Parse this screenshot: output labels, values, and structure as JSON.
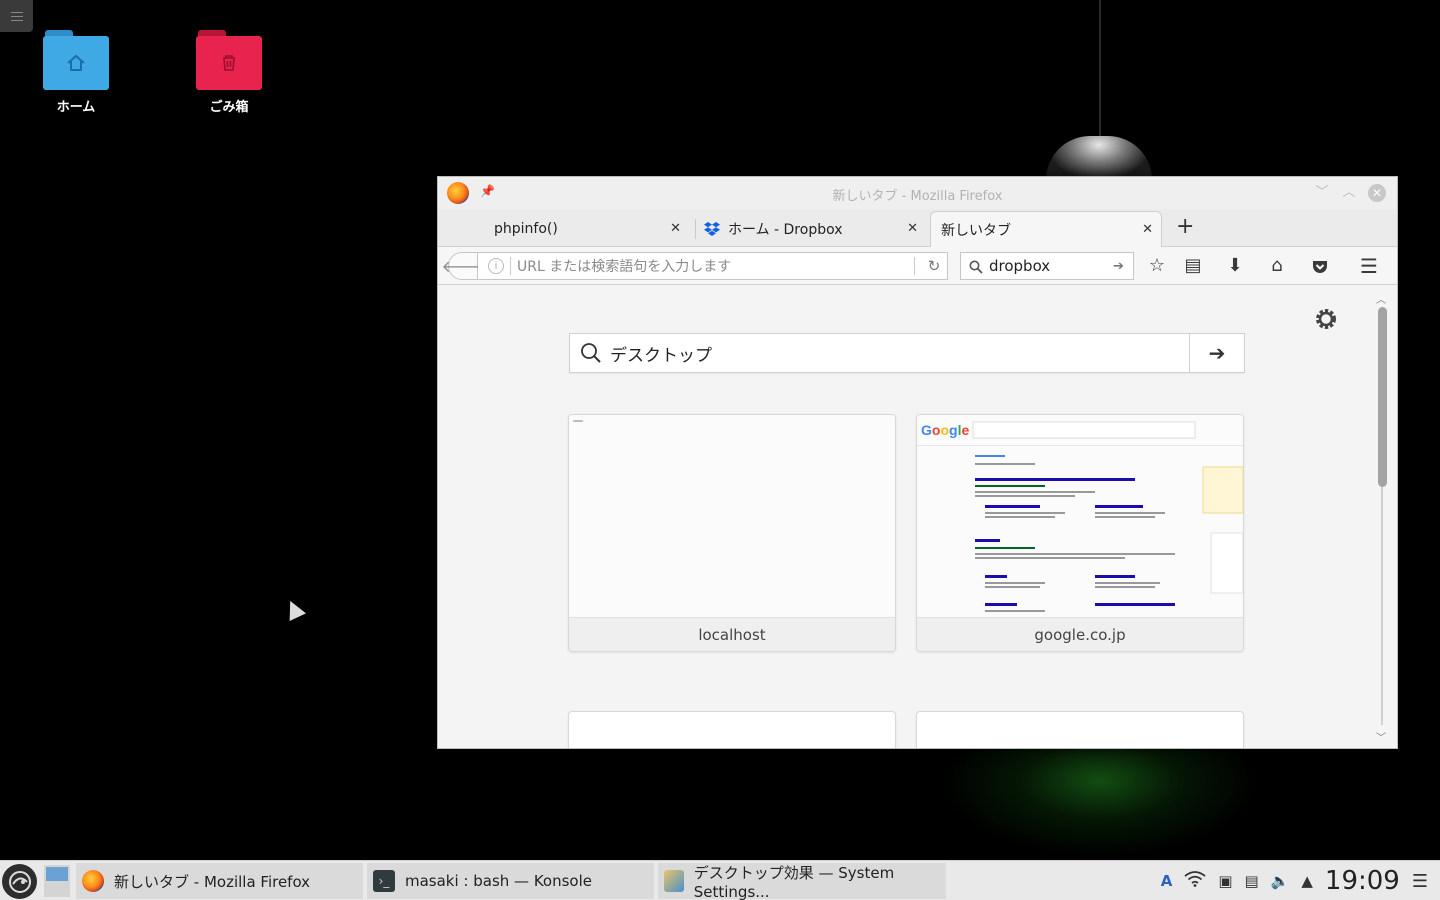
{
  "desktop": {
    "icons": [
      {
        "label": "ホーム"
      },
      {
        "label": "ごみ箱"
      }
    ]
  },
  "window": {
    "title": "新しいタブ - Mozilla Firefox",
    "tabs": [
      {
        "label": "phpinfo()"
      },
      {
        "label": "ホーム - Dropbox"
      },
      {
        "label": "新しいタブ"
      }
    ],
    "url_placeholder": "URL または検索語句を入力します",
    "search_value": "dropbox",
    "content": {
      "search_value": "デスクトップ",
      "tiles": [
        {
          "caption": "localhost"
        },
        {
          "caption": "google.co.jp"
        }
      ]
    }
  },
  "taskbar": {
    "tasks": [
      {
        "label": "新しいタブ - Mozilla Firefox"
      },
      {
        "label": "masaki : bash — Konsole"
      },
      {
        "label": "デスクトップ効果 — System Settings..."
      }
    ],
    "clock": "19:09"
  },
  "colors": {
    "home_folder": "#3fa9e6",
    "trash_folder": "#e8234e",
    "google_blue": "#4285f4",
    "google_red": "#ea4335"
  }
}
